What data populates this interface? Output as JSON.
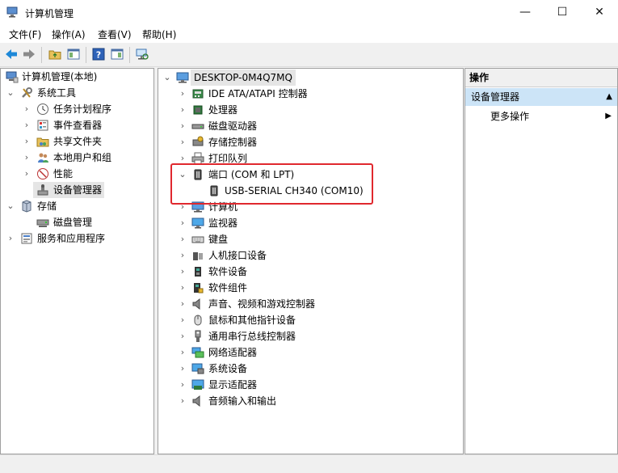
{
  "window": {
    "title": "计算机管理"
  },
  "menu": [
    "文件(F)",
    "操作(A)",
    "查看(V)",
    "帮助(H)"
  ],
  "left_tree": {
    "root": "计算机管理(本地)",
    "system_tools": "系统工具",
    "items": [
      "任务计划程序",
      "事件查看器",
      "共享文件夹",
      "本地用户和组",
      "性能",
      "设备管理器"
    ],
    "storage": "存储",
    "disk_management": "磁盘管理",
    "services": "服务和应用程序"
  },
  "device_tree": {
    "computer_name": "DESKTOP-0M4Q7MQ",
    "categories": {
      "ide": "IDE ATA/ATAPI 控制器",
      "processor": "处理器",
      "disk": "磁盘驱动器",
      "storage_ctrl": "存储控制器",
      "print_queue": "打印队列",
      "ports": "端口 (COM 和 LPT)",
      "computer": "计算机",
      "monitor": "监视器",
      "keyboard": "键盘",
      "hid": "人机接口设备",
      "software_device": "软件设备",
      "software_component": "软件组件",
      "audio_video": "声音、视频和游戏控制器",
      "mouse": "鼠标和其他指针设备",
      "usb": "通用串行总线控制器",
      "network": "网络适配器",
      "system": "系统设备",
      "display": "显示适配器",
      "audio_io": "音频输入和输出"
    },
    "port_device": "USB-SERIAL CH340 (COM10)"
  },
  "actions": {
    "header": "操作",
    "section": "设备管理器",
    "more": "更多操作"
  },
  "colors": {
    "highlight": "#e0282e",
    "selection": "#cce4f7"
  }
}
